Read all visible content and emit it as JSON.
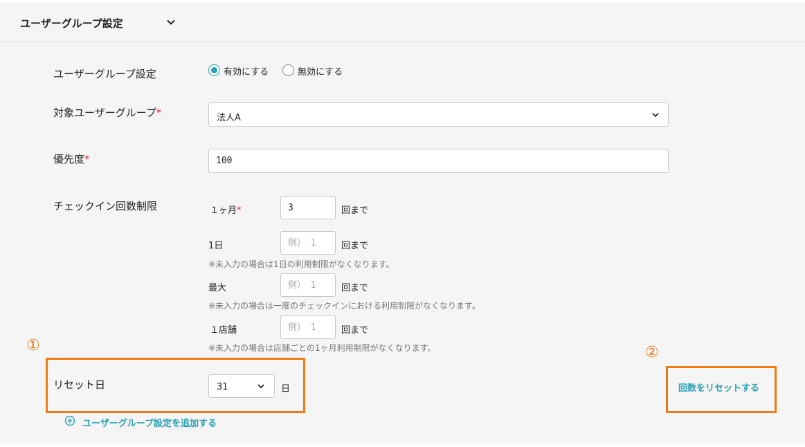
{
  "section": {
    "title": "ユーザーグループ設定"
  },
  "form": {
    "group_setting": {
      "label": "ユーザーグループ設定",
      "options": [
        "有効にする",
        "無効にする"
      ],
      "selected": "有効にする"
    },
    "target_group": {
      "label": "対象ユーザーグループ",
      "required_mark": "*",
      "value": "法人A"
    },
    "priority": {
      "label": "優先度",
      "required_mark": "*",
      "value": "100"
    },
    "checkin_limit": {
      "label": "チェックイン回数制限",
      "rows": [
        {
          "label": "１ヶ月",
          "required_mark": "*",
          "value": "3",
          "placeholder": "例）　1",
          "unit": "回まで",
          "note": ""
        },
        {
          "label": "1日",
          "required_mark": "",
          "value": "",
          "placeholder": "例）　1",
          "unit": "回まで",
          "note": "※未入力の場合は1日の利用制限がなくなります。"
        },
        {
          "label": "最大",
          "required_mark": "",
          "value": "",
          "placeholder": "例）　1",
          "unit": "回まで",
          "note": "※未入力の場合は一度のチェックインにおける利用制限がなくなります。"
        },
        {
          "label": "１店舗",
          "required_mark": "",
          "value": "",
          "placeholder": "例）　1",
          "unit": "回まで",
          "note": "※未入力の場合は店舗ごとの1ヶ月利用制限がなくなります。"
        }
      ]
    },
    "reset_day": {
      "label": "リセット日",
      "value": "31",
      "unit": "日"
    }
  },
  "annotations": {
    "marker_1": "①",
    "marker_2": "②",
    "color": "#f07a14"
  },
  "actions": {
    "reset_count": "回数をリセットする",
    "add_group": "ユーザーグループ設定を追加する"
  },
  "colors": {
    "accent": "#2aa0b5",
    "required": "#d32f2f",
    "panel_bg": "#f5f5f5"
  },
  "icons": {
    "collapse": "chevron-down-icon",
    "select": "chevron-down-icon",
    "add": "plus-circle-icon"
  }
}
